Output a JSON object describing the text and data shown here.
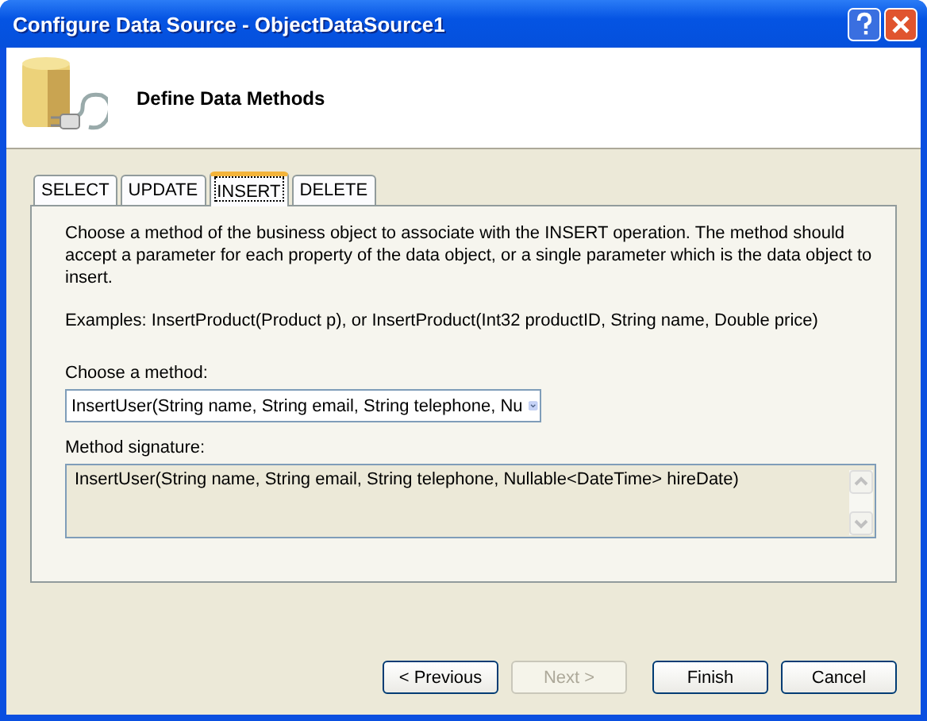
{
  "window": {
    "title": "Configure Data Source - ObjectDataSource1"
  },
  "header": {
    "title": "Define Data Methods"
  },
  "tabs": [
    {
      "label": "SELECT",
      "selected": false
    },
    {
      "label": "UPDATE",
      "selected": false
    },
    {
      "label": "INSERT",
      "selected": true
    },
    {
      "label": "DELETE",
      "selected": false
    }
  ],
  "description": "Choose a method of the business object to associate with the INSERT operation. The method should accept a parameter for each property of the data object, or a single parameter which is the data object to insert.",
  "examples": "Examples: InsertProduct(Product p), or InsertProduct(Int32 productID, String name, Double price)",
  "method": {
    "label": "Choose a method:",
    "value": "InsertUser(String name, String email, String telephone, Nu"
  },
  "signature": {
    "label": "Method signature:",
    "value": "InsertUser(String name, String email, String telephone, Nullable<DateTime> hireDate)"
  },
  "buttons": [
    {
      "label": "< Previous",
      "disabled": false
    },
    {
      "label": "Next >",
      "disabled": true
    },
    {
      "label": "Finish",
      "disabled": false
    },
    {
      "label": "Cancel",
      "disabled": false
    }
  ]
}
